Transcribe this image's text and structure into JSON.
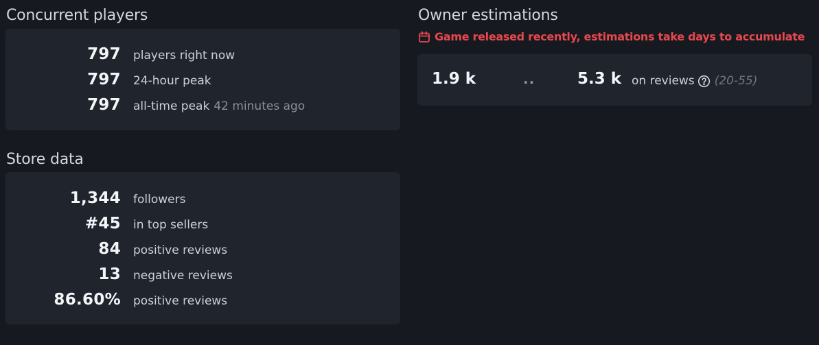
{
  "concurrent": {
    "title": "Concurrent players",
    "rows": [
      {
        "value": "797",
        "label": "players right now",
        "extra": ""
      },
      {
        "value": "797",
        "label": "24-hour peak",
        "extra": ""
      },
      {
        "value": "797",
        "label": "all-time peak",
        "extra": "42 minutes ago"
      }
    ]
  },
  "store": {
    "title": "Store data",
    "rows": [
      {
        "value": "1,344",
        "label": "followers"
      },
      {
        "value": "#45",
        "label": "in top sellers"
      },
      {
        "value": "84",
        "label": "positive reviews"
      },
      {
        "value": "13",
        "label": "negative reviews"
      },
      {
        "value": "86.60%",
        "label": "positive reviews"
      }
    ]
  },
  "owners": {
    "title": "Owner estimations",
    "warning": "Game released recently, estimations take days to accumulate",
    "low": "1.9 k",
    "separator": "..",
    "high": "5.3 k",
    "method": "on reviews",
    "range": "(20-55)"
  },
  "colors": {
    "background": "#16191f",
    "panel": "#1f242d",
    "warning": "#e5484d"
  },
  "icons": {
    "warning": "calendar-icon",
    "help": "question-circle-icon"
  }
}
